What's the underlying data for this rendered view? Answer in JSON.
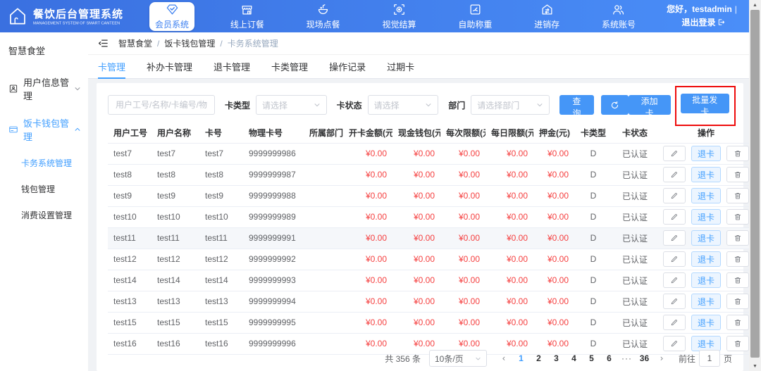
{
  "header": {
    "logo_title": "餐饮后台管理系统",
    "logo_subtitle": "MANAGEMENT SYSTEM OF SMART CANTEEN",
    "nav_items": [
      {
        "key": "member",
        "label": "会员系统",
        "icon": "diamond-member-icon",
        "active": true
      },
      {
        "key": "online",
        "label": "线上订餐",
        "icon": "storefront-icon",
        "active": false
      },
      {
        "key": "dinein",
        "label": "现场点餐",
        "icon": "dine-plate-icon",
        "active": false
      },
      {
        "key": "vision",
        "label": "视觉结算",
        "icon": "vision-scan-icon",
        "active": false
      },
      {
        "key": "weigh",
        "label": "自助称重",
        "icon": "scale-icon",
        "active": false
      },
      {
        "key": "inventory",
        "label": "进销存",
        "icon": "inventory-house-icon",
        "active": false
      },
      {
        "key": "account",
        "label": "系统账号",
        "icon": "accounts-people-icon",
        "active": false
      }
    ],
    "greeting": "您好，testadmin",
    "divider": "|",
    "logout_label": "退出登录"
  },
  "sidebar": {
    "title": "智慧食堂",
    "menus": [
      {
        "key": "user-info",
        "label": "用户信息管理",
        "icon": "user-info-icon",
        "expanded": false,
        "blue": false,
        "children": []
      },
      {
        "key": "card-wallet",
        "label": "饭卡钱包管理",
        "icon": "wallet-card-icon",
        "expanded": true,
        "blue": true,
        "children": [
          {
            "label": "卡务系统管理",
            "active": true
          },
          {
            "label": "钱包管理",
            "active": false
          },
          {
            "label": "消费设置管理",
            "active": false
          }
        ]
      }
    ]
  },
  "breadcrumb": [
    "智慧食堂",
    "饭卡钱包管理",
    "卡务系统管理"
  ],
  "tabs": {
    "items": [
      "卡管理",
      "补办卡管理",
      "退卡管理",
      "卡类管理",
      "操作记录",
      "过期卡"
    ],
    "active": "卡管理"
  },
  "filters": {
    "keyword_placeholder": "用户工号/名称/卡编号/物理卡号",
    "card_type_label": "卡类型",
    "card_type_placeholder": "请选择",
    "card_status_label": "卡状态",
    "card_status_placeholder": "请选择",
    "department_label": "部门",
    "department_placeholder": "请选择部门",
    "search_button": "查询",
    "add_card_button": "添加卡",
    "batch_issue_button": "批量发卡"
  },
  "annotation": {
    "type": "red-box",
    "target": "批量发卡"
  },
  "table": {
    "headers": [
      "用户工号",
      "用户名称",
      "卡号",
      "物理卡号",
      "所属部门",
      "开卡金额(元)",
      "现金钱包(元)",
      "每次限额(元)",
      "每日限额(元)",
      "押金(元)",
      "卡类型",
      "卡状态",
      "操作"
    ],
    "retreat_button": "退卡",
    "rows": [
      {
        "user_id": "test7",
        "user_name": "test7",
        "card_no": "test7",
        "physical_card_no": "9999999986",
        "department": "",
        "open_amount": "¥0.00",
        "cash_wallet": "¥0.00",
        "per_limit": "¥0.00",
        "daily_limit": "¥0.00",
        "deposit": "¥0.00",
        "card_type": "D",
        "card_status": "已认证",
        "highlighted": false
      },
      {
        "user_id": "test8",
        "user_name": "test8",
        "card_no": "test8",
        "physical_card_no": "9999999987",
        "department": "",
        "open_amount": "¥0.00",
        "cash_wallet": "¥0.00",
        "per_limit": "¥0.00",
        "daily_limit": "¥0.00",
        "deposit": "¥0.00",
        "card_type": "D",
        "card_status": "已认证",
        "highlighted": false
      },
      {
        "user_id": "test9",
        "user_name": "test9",
        "card_no": "test9",
        "physical_card_no": "9999999988",
        "department": "",
        "open_amount": "¥0.00",
        "cash_wallet": "¥0.00",
        "per_limit": "¥0.00",
        "daily_limit": "¥0.00",
        "deposit": "¥0.00",
        "card_type": "D",
        "card_status": "已认证",
        "highlighted": false
      },
      {
        "user_id": "test10",
        "user_name": "test10",
        "card_no": "test10",
        "physical_card_no": "9999999989",
        "department": "",
        "open_amount": "¥0.00",
        "cash_wallet": "¥0.00",
        "per_limit": "¥0.00",
        "daily_limit": "¥0.00",
        "deposit": "¥0.00",
        "card_type": "D",
        "card_status": "已认证",
        "highlighted": false
      },
      {
        "user_id": "test11",
        "user_name": "test11",
        "card_no": "test11",
        "physical_card_no": "9999999991",
        "department": "",
        "open_amount": "¥0.00",
        "cash_wallet": "¥0.00",
        "per_limit": "¥0.00",
        "daily_limit": "¥0.00",
        "deposit": "¥0.00",
        "card_type": "D",
        "card_status": "已认证",
        "highlighted": true
      },
      {
        "user_id": "test12",
        "user_name": "test12",
        "card_no": "test12",
        "physical_card_no": "9999999992",
        "department": "",
        "open_amount": "¥0.00",
        "cash_wallet": "¥0.00",
        "per_limit": "¥0.00",
        "daily_limit": "¥0.00",
        "deposit": "¥0.00",
        "card_type": "D",
        "card_status": "已认证",
        "highlighted": false
      },
      {
        "user_id": "test14",
        "user_name": "test14",
        "card_no": "test14",
        "physical_card_no": "9999999993",
        "department": "",
        "open_amount": "¥0.00",
        "cash_wallet": "¥0.00",
        "per_limit": "¥0.00",
        "daily_limit": "¥0.00",
        "deposit": "¥0.00",
        "card_type": "D",
        "card_status": "已认证",
        "highlighted": false
      },
      {
        "user_id": "test13",
        "user_name": "test13",
        "card_no": "test13",
        "physical_card_no": "9999999994",
        "department": "",
        "open_amount": "¥0.00",
        "cash_wallet": "¥0.00",
        "per_limit": "¥0.00",
        "daily_limit": "¥0.00",
        "deposit": "¥0.00",
        "card_type": "D",
        "card_status": "已认证",
        "highlighted": false
      },
      {
        "user_id": "test15",
        "user_name": "test15",
        "card_no": "test15",
        "physical_card_no": "9999999995",
        "department": "",
        "open_amount": "¥0.00",
        "cash_wallet": "¥0.00",
        "per_limit": "¥0.00",
        "daily_limit": "¥0.00",
        "deposit": "¥0.00",
        "card_type": "D",
        "card_status": "已认证",
        "highlighted": false
      },
      {
        "user_id": "test16",
        "user_name": "test16",
        "card_no": "test16",
        "physical_card_no": "9999999996",
        "department": "",
        "open_amount": "¥0.00",
        "cash_wallet": "¥0.00",
        "per_limit": "¥0.00",
        "daily_limit": "¥0.00",
        "deposit": "¥0.00",
        "card_type": "D",
        "card_status": "已认证",
        "highlighted": false
      }
    ]
  },
  "pagination": {
    "total": "共 356 条",
    "page_size": "10条/页",
    "prev": "‹",
    "next": "›",
    "pages": [
      "1",
      "2",
      "3",
      "4",
      "5",
      "6",
      "···",
      "36"
    ],
    "active_page": "1",
    "goto_label": "前往",
    "goto_value": "1",
    "goto_suffix": "页"
  },
  "colors": {
    "header_blue": "#3f7ceb",
    "primary_blue": "#409eff",
    "money_red": "#f53f3f",
    "annotation_red": "#ee0b0b",
    "breadcrumb_current": "#97a8be"
  }
}
